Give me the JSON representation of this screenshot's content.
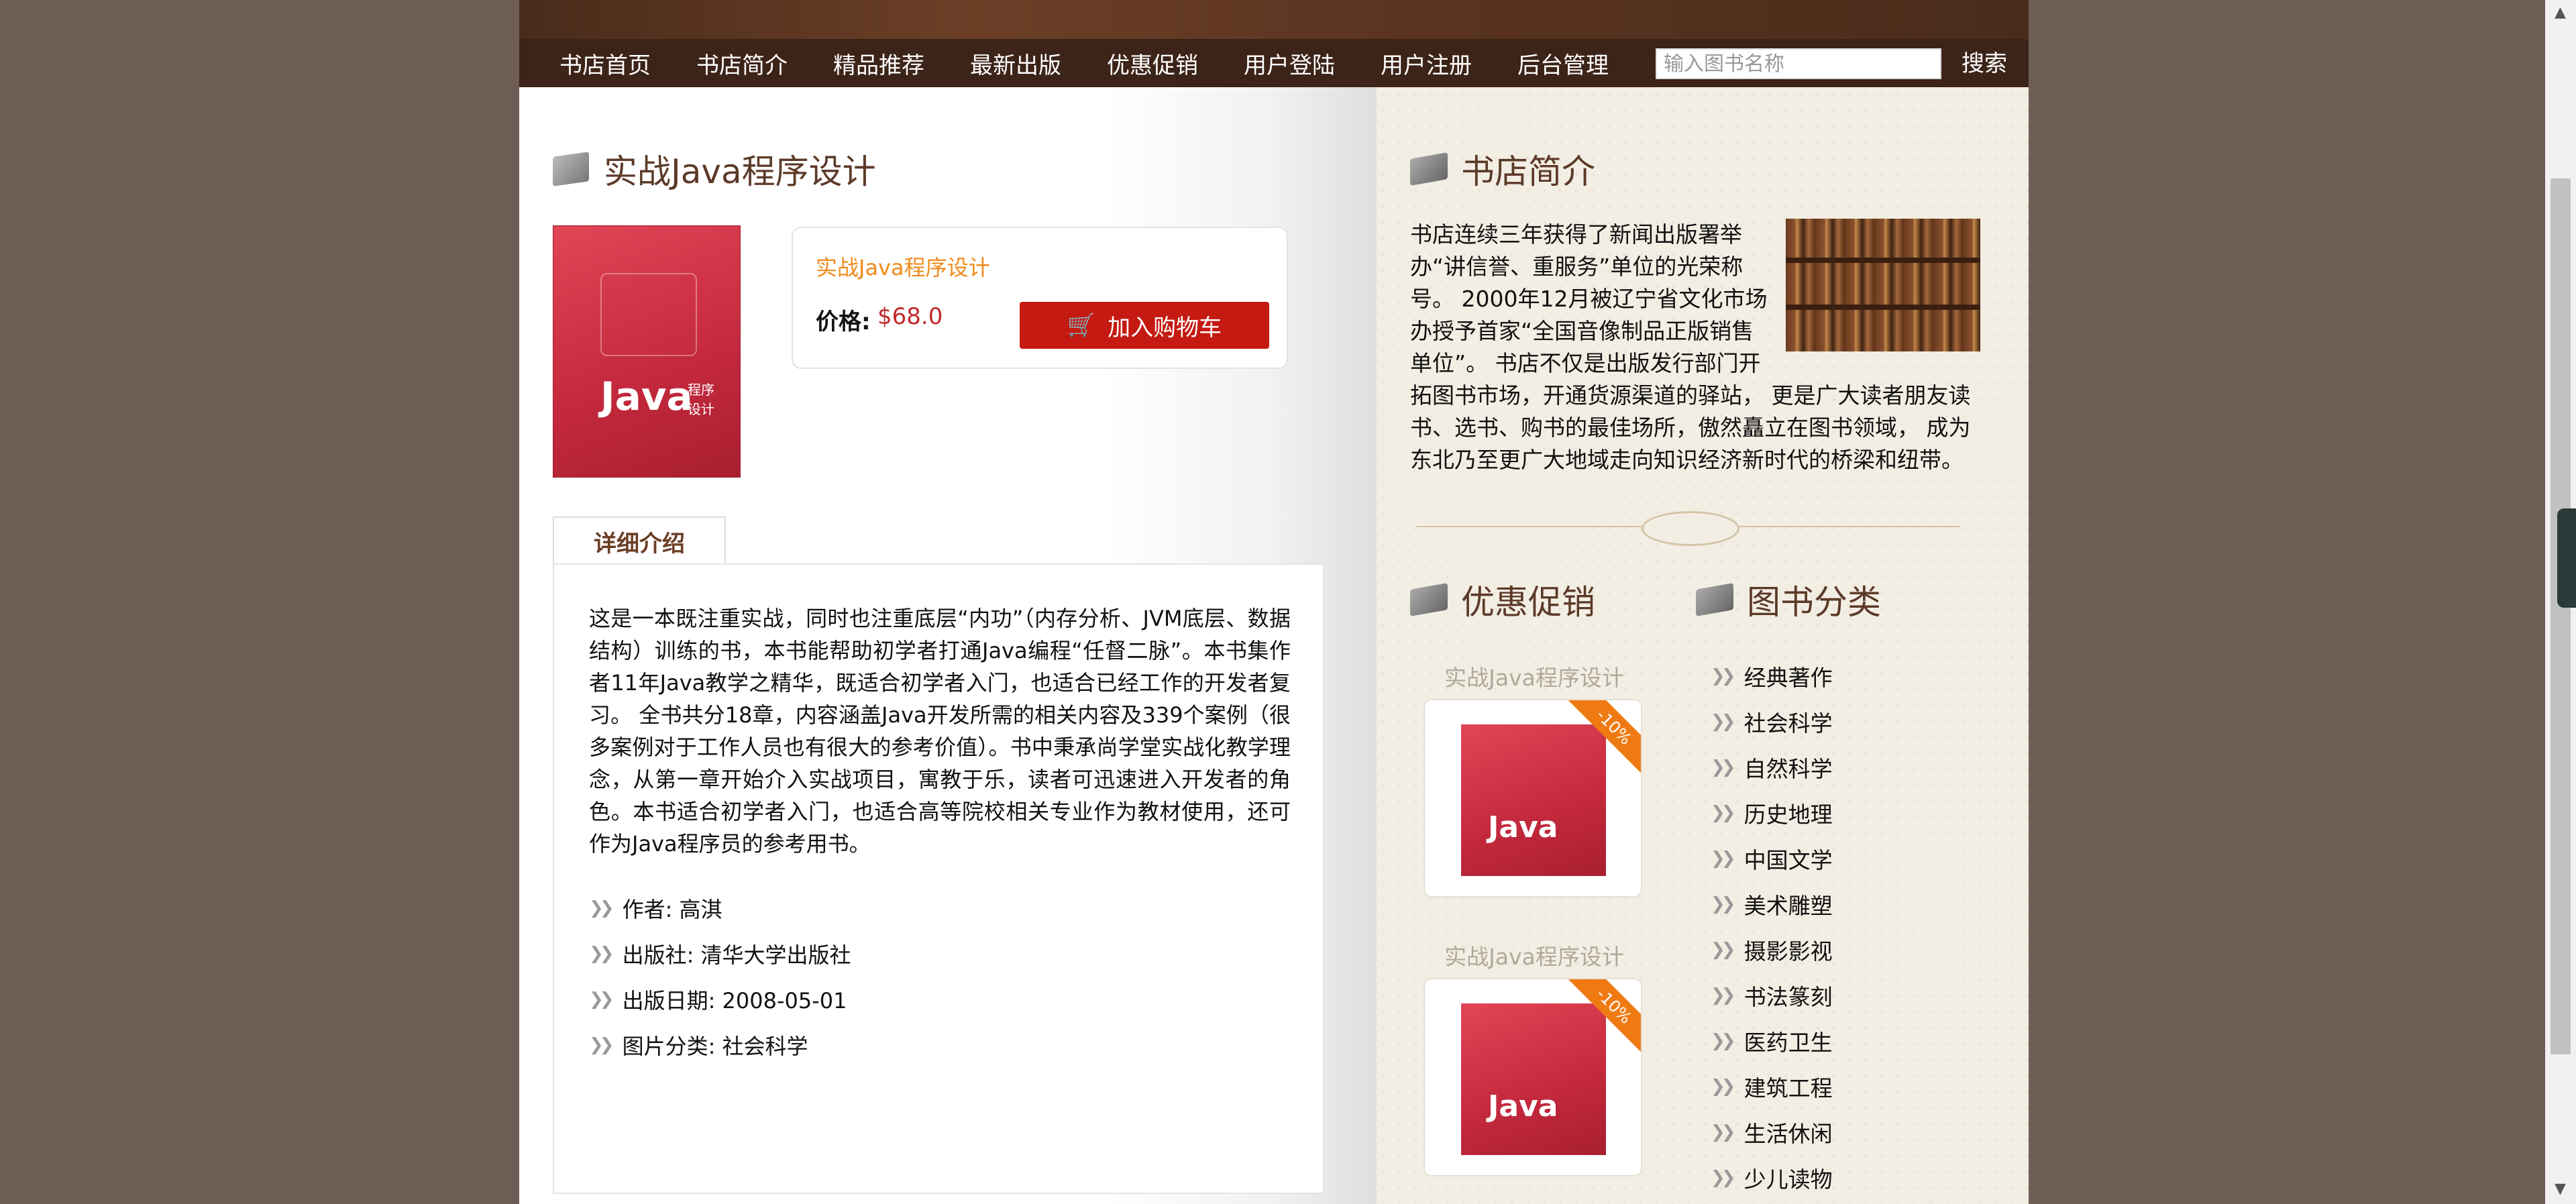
{
  "nav": {
    "items": [
      {
        "label": "书店首页"
      },
      {
        "label": "书店简介"
      },
      {
        "label": "精品推荐"
      },
      {
        "label": "最新出版"
      },
      {
        "label": "优惠促销"
      },
      {
        "label": "用户登陆"
      },
      {
        "label": "用户注册"
      },
      {
        "label": "后台管理"
      }
    ],
    "search_placeholder": "输入图书名称",
    "search_label": "搜索"
  },
  "book": {
    "heading": "实战Java程序设计",
    "name": "实战Java程序设计",
    "price_label": "价格:",
    "price": "$68.0",
    "cart_label": "加入购物车",
    "cover_title": "Java",
    "cover_sub": "程序设计",
    "tab_label": "详细介绍",
    "description": "这是一本既注重实战，同时也注重底层“内功”（内存分析、JVM底层、数据结构）训练的书，本书能帮助初学者打通Java编程“任督二脉”。本书集作者11年Java教学之精华，既适合初学者入门，也适合已经工作的开发者复习。 全书共分18章，内容涵盖Java开发所需的相关内容及339个案例（很多案例对于工作人员也有很大的参考价值）。书中秉承尚学堂实战化教学理念，从第一章开始介入实战项目，寓教于乐，读者可迅速进入开发者的角色。本书适合初学者入门，也适合高等院校相关专业作为教材使用，还可作为Java程序员的参考用书。",
    "meta": [
      {
        "text": "作者: 高淇"
      },
      {
        "text": "出版社: 清华大学出版社"
      },
      {
        "text": "出版日期: 2008-05-01"
      },
      {
        "text": "图片分类: 社会科学"
      }
    ]
  },
  "sidebar": {
    "intro_title": "书店简介",
    "intro_text": "书店连续三年获得了新闻出版署举办“讲信誉、重服务”单位的光荣称号。 2000年12月被辽宁省文化市场办授予首家“全国音像制品正版销售单位”。 书店不仅是出版发行部门开拓图书市场，开通货源渠道的驿站， 更是广大读者朋友读书、选书、购书的最佳场所，傲然矗立在图书领域， 成为东北乃至更广大地域走向知识经济新时代的桥梁和纽带。",
    "promo_title": "优惠促销",
    "category_title": "图书分类",
    "promos": [
      {
        "name": "实战Java程序设计",
        "badge": "-10%",
        "cover_text": "Java"
      },
      {
        "name": "实战Java程序设计",
        "badge": "-10%",
        "cover_text": "Java"
      }
    ],
    "categories": [
      {
        "label": "经典著作"
      },
      {
        "label": "社会科学"
      },
      {
        "label": "自然科学"
      },
      {
        "label": "历史地理"
      },
      {
        "label": "中国文学"
      },
      {
        "label": "美术雕塑"
      },
      {
        "label": "摄影影视"
      },
      {
        "label": "书法篆刻"
      },
      {
        "label": "医药卫生"
      },
      {
        "label": "建筑工程"
      },
      {
        "label": "生活休闲"
      },
      {
        "label": "少儿读物"
      }
    ]
  },
  "icons": {
    "cart": "cart-icon",
    "chevron": "double-chevron-right-icon",
    "book": "book-icon"
  },
  "colors": {
    "nav_bg": "#3d2418",
    "cart_button": "#c41a11",
    "price": "#c0282a",
    "book_name": "#f08a1c",
    "heading": "#5c3a28",
    "badge": "#f07a12"
  }
}
